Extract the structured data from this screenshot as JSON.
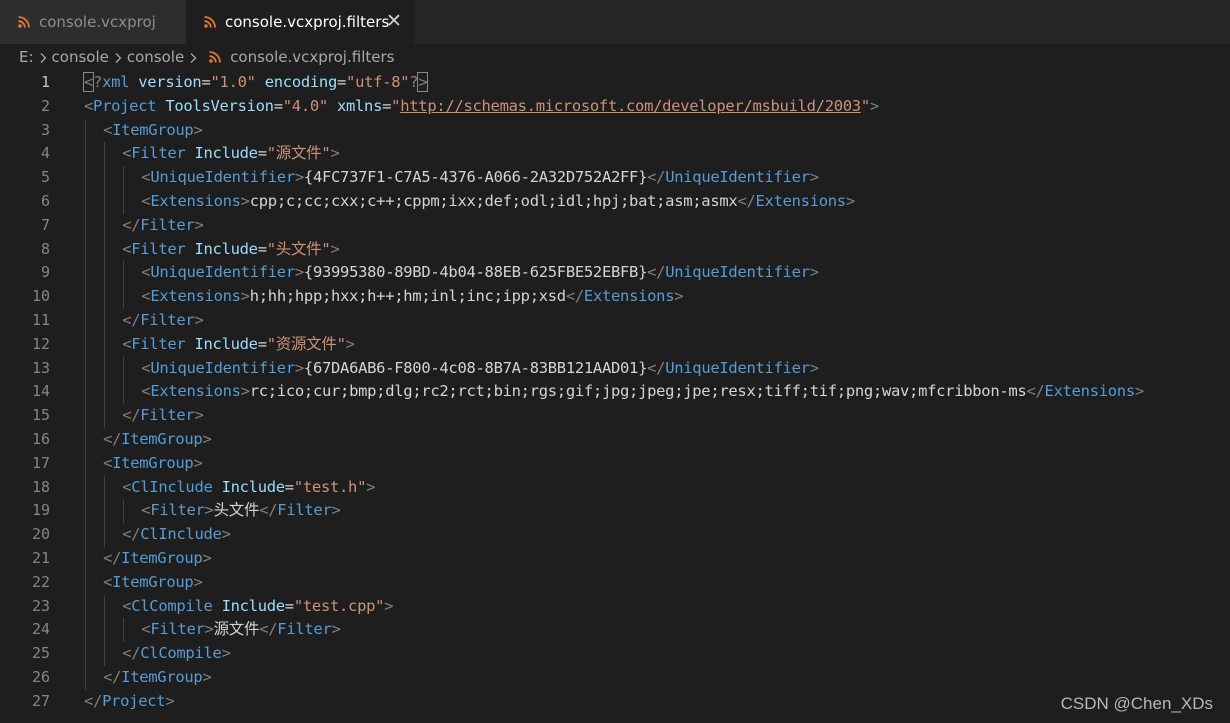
{
  "tabs": [
    {
      "label": "console.vcxproj",
      "active": false
    },
    {
      "label": "console.vcxproj.filters",
      "active": true
    }
  ],
  "tab_close_glyph": "✕",
  "breadcrumb": [
    "E:",
    "console",
    "console",
    "console.vcxproj.filters"
  ],
  "watermark": "CSDN @Chen_XDs",
  "colors": {
    "tag": "#569cd6",
    "punct": "#808080",
    "attr": "#9cdcfe",
    "string": "#ce9178",
    "text": "#d4d4d4",
    "icon": "#e37933"
  },
  "current_line": 1,
  "lines": [
    {
      "n": "1",
      "indent": 0,
      "tokens": [
        [
          "pb",
          "<"
        ],
        [
          "p",
          "?"
        ],
        [
          "t",
          "xml "
        ],
        [
          "a",
          "version"
        ],
        [
          "w",
          "="
        ],
        [
          "s",
          "\"1.0\" "
        ],
        [
          "a",
          "encoding"
        ],
        [
          "w",
          "="
        ],
        [
          "s",
          "\"utf-8\""
        ],
        [
          "p",
          "?"
        ],
        [
          "pb",
          ">"
        ]
      ]
    },
    {
      "n": "2",
      "indent": 0,
      "tokens": [
        [
          "p",
          "<"
        ],
        [
          "t",
          "Project "
        ],
        [
          "a",
          "ToolsVersion"
        ],
        [
          "w",
          "="
        ],
        [
          "s",
          "\"4.0\" "
        ],
        [
          "a",
          "xmlns"
        ],
        [
          "w",
          "="
        ],
        [
          "s",
          "\""
        ],
        [
          "u",
          "http://schemas.microsoft.com/developer/msbuild/2003"
        ],
        [
          "s",
          "\""
        ],
        [
          "p",
          ">"
        ]
      ]
    },
    {
      "n": "3",
      "indent": 1,
      "tokens": [
        [
          "p",
          "<"
        ],
        [
          "t",
          "ItemGroup"
        ],
        [
          "p",
          ">"
        ]
      ]
    },
    {
      "n": "4",
      "indent": 2,
      "tokens": [
        [
          "p",
          "<"
        ],
        [
          "t",
          "Filter "
        ],
        [
          "a",
          "Include"
        ],
        [
          "w",
          "="
        ],
        [
          "s",
          "\"源文件\""
        ],
        [
          "p",
          ">"
        ]
      ]
    },
    {
      "n": "5",
      "indent": 3,
      "tokens": [
        [
          "p",
          "<"
        ],
        [
          "t",
          "UniqueIdentifier"
        ],
        [
          "p",
          ">"
        ],
        [
          "w",
          "{4FC737F1-C7A5-4376-A066-2A32D752A2FF}"
        ],
        [
          "p",
          "</"
        ],
        [
          "t",
          "UniqueIdentifier"
        ],
        [
          "p",
          ">"
        ]
      ]
    },
    {
      "n": "6",
      "indent": 3,
      "tokens": [
        [
          "p",
          "<"
        ],
        [
          "t",
          "Extensions"
        ],
        [
          "p",
          ">"
        ],
        [
          "w",
          "cpp;c;cc;cxx;c++;cppm;ixx;def;odl;idl;hpj;bat;asm;asmx"
        ],
        [
          "p",
          "</"
        ],
        [
          "t",
          "Extensions"
        ],
        [
          "p",
          ">"
        ]
      ]
    },
    {
      "n": "7",
      "indent": 2,
      "tokens": [
        [
          "p",
          "</"
        ],
        [
          "t",
          "Filter"
        ],
        [
          "p",
          ">"
        ]
      ]
    },
    {
      "n": "8",
      "indent": 2,
      "tokens": [
        [
          "p",
          "<"
        ],
        [
          "t",
          "Filter "
        ],
        [
          "a",
          "Include"
        ],
        [
          "w",
          "="
        ],
        [
          "s",
          "\"头文件\""
        ],
        [
          "p",
          ">"
        ]
      ]
    },
    {
      "n": "9",
      "indent": 3,
      "tokens": [
        [
          "p",
          "<"
        ],
        [
          "t",
          "UniqueIdentifier"
        ],
        [
          "p",
          ">"
        ],
        [
          "w",
          "{93995380-89BD-4b04-88EB-625FBE52EBFB}"
        ],
        [
          "p",
          "</"
        ],
        [
          "t",
          "UniqueIdentifier"
        ],
        [
          "p",
          ">"
        ]
      ]
    },
    {
      "n": "10",
      "indent": 3,
      "tokens": [
        [
          "p",
          "<"
        ],
        [
          "t",
          "Extensions"
        ],
        [
          "p",
          ">"
        ],
        [
          "w",
          "h;hh;hpp;hxx;h++;hm;inl;inc;ipp;xsd"
        ],
        [
          "p",
          "</"
        ],
        [
          "t",
          "Extensions"
        ],
        [
          "p",
          ">"
        ]
      ]
    },
    {
      "n": "11",
      "indent": 2,
      "tokens": [
        [
          "p",
          "</"
        ],
        [
          "t",
          "Filter"
        ],
        [
          "p",
          ">"
        ]
      ]
    },
    {
      "n": "12",
      "indent": 2,
      "tokens": [
        [
          "p",
          "<"
        ],
        [
          "t",
          "Filter "
        ],
        [
          "a",
          "Include"
        ],
        [
          "w",
          "="
        ],
        [
          "s",
          "\"资源文件\""
        ],
        [
          "p",
          ">"
        ]
      ]
    },
    {
      "n": "13",
      "indent": 3,
      "tokens": [
        [
          "p",
          "<"
        ],
        [
          "t",
          "UniqueIdentifier"
        ],
        [
          "p",
          ">"
        ],
        [
          "w",
          "{67DA6AB6-F800-4c08-8B7A-83BB121AAD01}"
        ],
        [
          "p",
          "</"
        ],
        [
          "t",
          "UniqueIdentifier"
        ],
        [
          "p",
          ">"
        ]
      ]
    },
    {
      "n": "14",
      "indent": 3,
      "tokens": [
        [
          "p",
          "<"
        ],
        [
          "t",
          "Extensions"
        ],
        [
          "p",
          ">"
        ],
        [
          "w",
          "rc;ico;cur;bmp;dlg;rc2;rct;bin;rgs;gif;jpg;jpeg;jpe;resx;tiff;tif;png;wav;mfcribbon-ms"
        ],
        [
          "p",
          "</"
        ],
        [
          "t",
          "Extensions"
        ],
        [
          "p",
          ">"
        ]
      ]
    },
    {
      "n": "15",
      "indent": 2,
      "tokens": [
        [
          "p",
          "</"
        ],
        [
          "t",
          "Filter"
        ],
        [
          "p",
          ">"
        ]
      ]
    },
    {
      "n": "16",
      "indent": 1,
      "tokens": [
        [
          "p",
          "</"
        ],
        [
          "t",
          "ItemGroup"
        ],
        [
          "p",
          ">"
        ]
      ]
    },
    {
      "n": "17",
      "indent": 1,
      "tokens": [
        [
          "p",
          "<"
        ],
        [
          "t",
          "ItemGroup"
        ],
        [
          "p",
          ">"
        ]
      ]
    },
    {
      "n": "18",
      "indent": 2,
      "tokens": [
        [
          "p",
          "<"
        ],
        [
          "t",
          "ClInclude "
        ],
        [
          "a",
          "Include"
        ],
        [
          "w",
          "="
        ],
        [
          "s",
          "\"test.h\""
        ],
        [
          "p",
          ">"
        ]
      ]
    },
    {
      "n": "19",
      "indent": 3,
      "tokens": [
        [
          "p",
          "<"
        ],
        [
          "t",
          "Filter"
        ],
        [
          "p",
          ">"
        ],
        [
          "w",
          "头文件"
        ],
        [
          "p",
          "</"
        ],
        [
          "t",
          "Filter"
        ],
        [
          "p",
          ">"
        ]
      ]
    },
    {
      "n": "20",
      "indent": 2,
      "tokens": [
        [
          "p",
          "</"
        ],
        [
          "t",
          "ClInclude"
        ],
        [
          "p",
          ">"
        ]
      ]
    },
    {
      "n": "21",
      "indent": 1,
      "tokens": [
        [
          "p",
          "</"
        ],
        [
          "t",
          "ItemGroup"
        ],
        [
          "p",
          ">"
        ]
      ]
    },
    {
      "n": "22",
      "indent": 1,
      "tokens": [
        [
          "p",
          "<"
        ],
        [
          "t",
          "ItemGroup"
        ],
        [
          "p",
          ">"
        ]
      ]
    },
    {
      "n": "23",
      "indent": 2,
      "tokens": [
        [
          "p",
          "<"
        ],
        [
          "t",
          "ClCompile "
        ],
        [
          "a",
          "Include"
        ],
        [
          "w",
          "="
        ],
        [
          "s",
          "\"test.cpp\""
        ],
        [
          "p",
          ">"
        ]
      ]
    },
    {
      "n": "24",
      "indent": 3,
      "tokens": [
        [
          "p",
          "<"
        ],
        [
          "t",
          "Filter"
        ],
        [
          "p",
          ">"
        ],
        [
          "w",
          "源文件"
        ],
        [
          "p",
          "</"
        ],
        [
          "t",
          "Filter"
        ],
        [
          "p",
          ">"
        ]
      ]
    },
    {
      "n": "25",
      "indent": 2,
      "tokens": [
        [
          "p",
          "</"
        ],
        [
          "t",
          "ClCompile"
        ],
        [
          "p",
          ">"
        ]
      ]
    },
    {
      "n": "26",
      "indent": 1,
      "tokens": [
        [
          "p",
          "</"
        ],
        [
          "t",
          "ItemGroup"
        ],
        [
          "p",
          ">"
        ]
      ]
    },
    {
      "n": "27",
      "indent": 0,
      "tokens": [
        [
          "p",
          "</"
        ],
        [
          "t",
          "Project"
        ],
        [
          "p",
          ">"
        ]
      ]
    }
  ]
}
